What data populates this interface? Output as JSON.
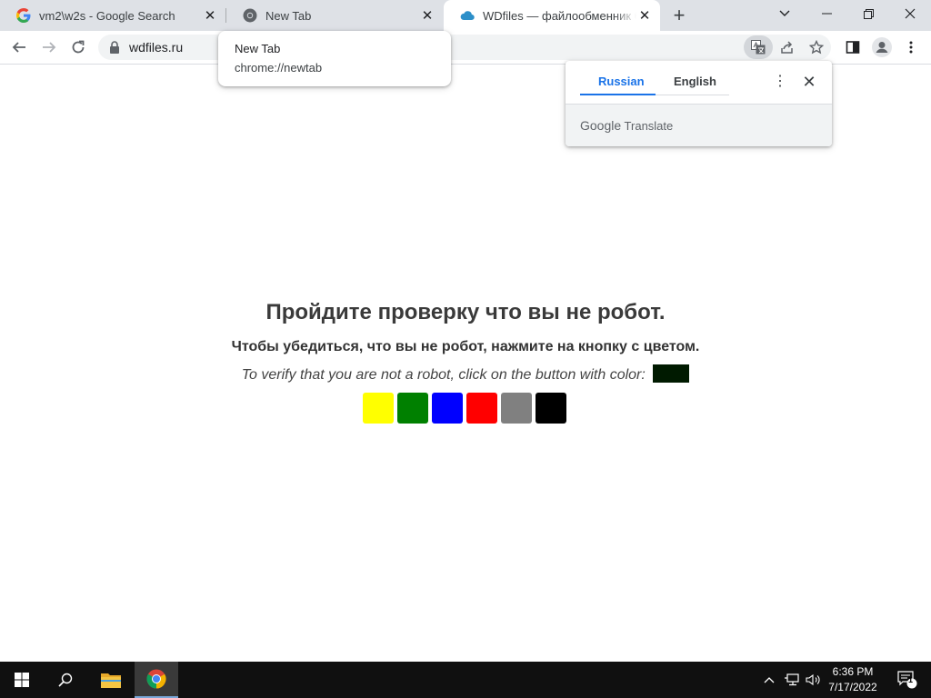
{
  "browser": {
    "tabs": [
      {
        "title": "vm2\\w2s - Google Search",
        "favicon": "google-g-icon"
      },
      {
        "title": "New Tab",
        "favicon": "chrome-icon"
      },
      {
        "title": "WDfiles — файлообменник бесплатно",
        "favicon": "cloud-icon"
      }
    ],
    "address": "wdfiles.ru"
  },
  "hover_card": {
    "title": "New Tab",
    "url": "chrome://newtab"
  },
  "translate_bubble": {
    "source_lang": "Russian",
    "target_lang": "English",
    "brand_google": "Google",
    "brand_translate": "Translate"
  },
  "page": {
    "heading": "Пройдите проверку что вы не робот.",
    "instruction_ru": "Чтобы убедиться, что вы не робот, нажмите на кнопку с цветом.",
    "instruction_en": "To verify that you are not a robot, click on the button with color:",
    "target_color": "#001a00",
    "swatches": [
      "#ffff00",
      "#008000",
      "#0000ff",
      "#ff0000",
      "#808080",
      "#000000"
    ]
  },
  "taskbar": {
    "time": "6:36 PM",
    "date": "7/17/2022",
    "notification_count": "1"
  }
}
